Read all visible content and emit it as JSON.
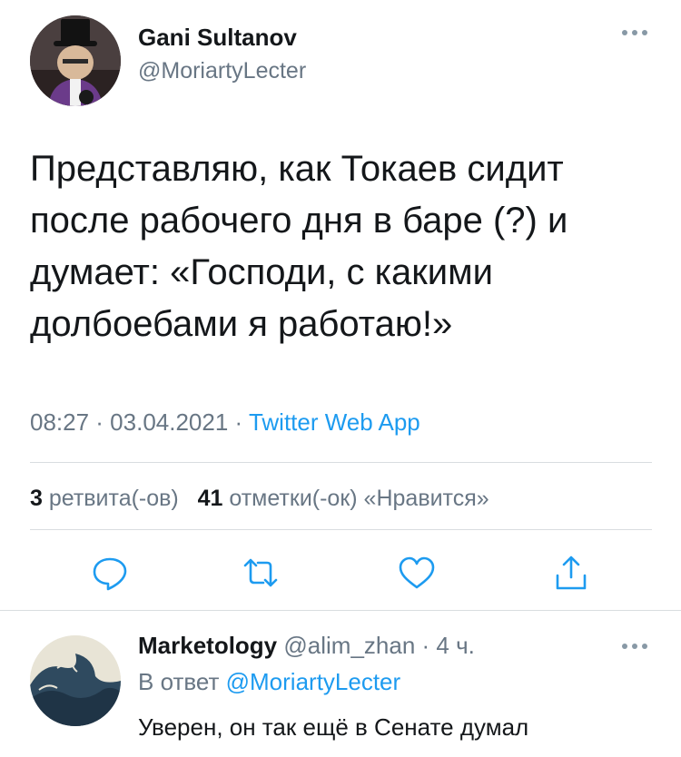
{
  "tweet": {
    "author_name": "Gani Sultanov",
    "author_handle": "@MoriartyLecter",
    "text": "Представляю, как Токаев сидит после рабочего дня в баре (?) и думает: «Господи, с какими долбоебами я работаю!»",
    "time": "08:27 · 03.04.2021 · ",
    "source": "Twitter Web App",
    "retweets_count": "3",
    "retweets_label": " ретвита(-ов)",
    "likes_count": "41",
    "likes_label": " отметки(-ок) «Нравится»"
  },
  "actions": [
    {
      "icon": "reply-icon"
    },
    {
      "icon": "retweet-icon"
    },
    {
      "icon": "like-icon"
    },
    {
      "icon": "share-icon"
    }
  ],
  "reply": {
    "author_name": "Marketology",
    "meta": " @alim_zhan · 4 ч.",
    "reply_to_prefix": "В ответ ",
    "reply_to_handle": "@MoriartyLecter",
    "text": "Уверен, он так ещё в Сенате думал"
  },
  "colors": {
    "accent": "#1d9bf0",
    "secondary_text": "#687684",
    "primary_text": "#14171a"
  }
}
